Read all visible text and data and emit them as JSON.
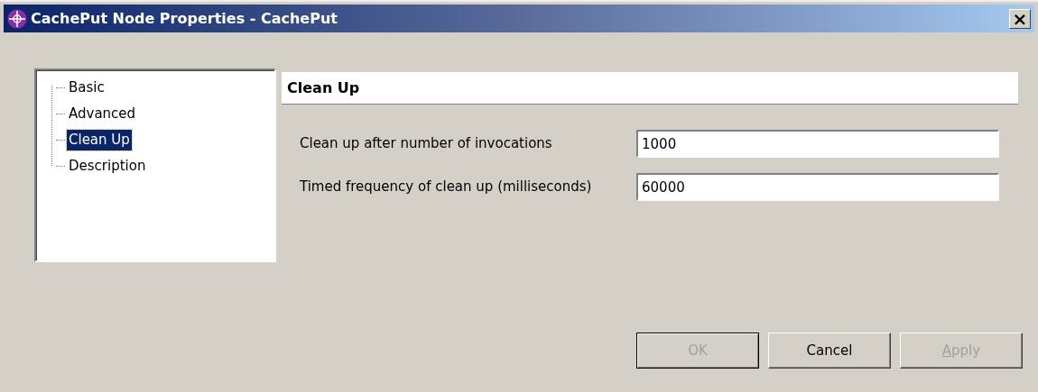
{
  "window": {
    "title": "CachePut Node Properties - CachePut",
    "close": "×"
  },
  "tree": {
    "items": [
      {
        "label": "Basic",
        "selected": false
      },
      {
        "label": "Advanced",
        "selected": false
      },
      {
        "label": "Clean Up",
        "selected": true
      },
      {
        "label": "Description",
        "selected": false
      }
    ]
  },
  "panel": {
    "title": "Clean Up",
    "fields": [
      {
        "label": "Clean up after number of invocations",
        "value": "1000"
      },
      {
        "label": "Timed frequency of clean up (milliseconds)",
        "value": "60000"
      }
    ]
  },
  "buttons": [
    {
      "label": "OK",
      "disabled": true,
      "default": true,
      "mnemonic": false
    },
    {
      "label": "Cancel",
      "disabled": false,
      "default": false,
      "mnemonic": false
    },
    {
      "label": "Apply",
      "disabled": true,
      "default": false,
      "mnemonic": true
    }
  ]
}
